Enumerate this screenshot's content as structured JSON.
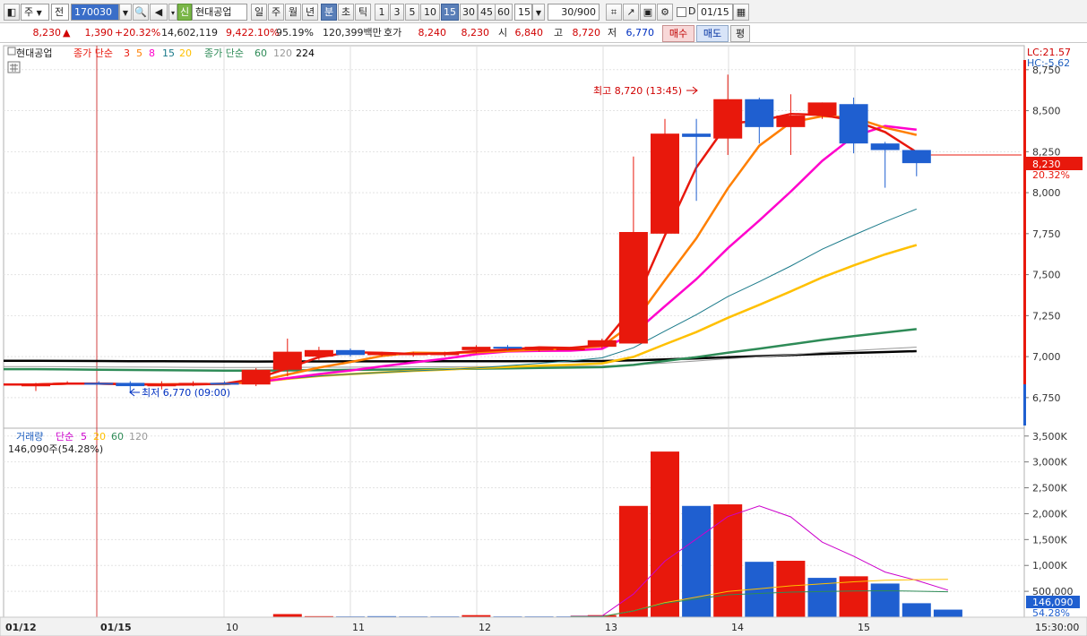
{
  "toolbar": {
    "stock_code": "170030",
    "stock_name": "현대공업",
    "badge": "신",
    "type_label": "주",
    "market_label": "전",
    "periods": [
      "일",
      "주",
      "월",
      "년",
      "분",
      "초",
      "틱"
    ],
    "active_period": "분",
    "intervals": [
      "1",
      "3",
      "5",
      "10",
      "15",
      "30",
      "45",
      "60"
    ],
    "active_interval": "15",
    "interval_value": "15",
    "count_value": "30",
    "count_total": "/900",
    "date_toggle_label": "D",
    "date_value": "01/15"
  },
  "quote": {
    "price": "8,230",
    "change": "1,390",
    "change_pct": "+20.32%",
    "volume": "14,602,119",
    "volume_pct": "9,422.10%",
    "rate": "95.19%",
    "amount": "120,399백만",
    "bid_label": "호가",
    "ask": "8,240",
    "bid": "8,230",
    "open_label": "시",
    "open": "6,840",
    "high_label": "고",
    "high": "8,720",
    "low_label": "저",
    "low": "6,770",
    "buy_label": "매수",
    "sell_label": "매도",
    "eval_label": "평"
  },
  "price_legend": {
    "name": "현대공업",
    "ma_label": "종가 단순",
    "ma_periods": [
      "3",
      "5",
      "8",
      "15",
      "20"
    ],
    "ma2_label": "종가 단순",
    "ma2_periods": [
      "60",
      "120",
      "224"
    ]
  },
  "volume_legend": {
    "label": "거래량",
    "ma_label": "단순",
    "ma_periods": [
      "5",
      "20",
      "60",
      "120"
    ],
    "current": "146,090주(54.28%)"
  },
  "annotations": {
    "high_label": "최고 8,720 (13:45)",
    "low_label": "최저 6,770 (09:00)",
    "lc": "LC:21.57",
    "hc": "HC:-5.62",
    "last_price": "8,230",
    "last_pct": "20.32%",
    "last_volume": "146,090",
    "last_volume_pct": "54.28%"
  },
  "colors": {
    "up": "#e8180c",
    "down": "#1f5fd0",
    "ma3": "#e8180c",
    "ma5": "#ff7f00",
    "ma8": "#ff00cc",
    "ma15": "#1a7a8a",
    "ma20": "#ffc000",
    "ma60": "#2e8b57",
    "ma120": "#999999",
    "ma224": "#000000"
  },
  "chart_data": {
    "type": "candlestick",
    "price_axis": {
      "ticks": [
        "8,750",
        "8,500",
        "8,250",
        "8,000",
        "7,750",
        "7,500",
        "7,250",
        "7,000",
        "6,750"
      ],
      "ylim": [
        6580,
        8880
      ]
    },
    "volume_axis": {
      "ticks": [
        "3,500K",
        "3,000K",
        "2,500K",
        "2,000K",
        "1,500K",
        "1,000K",
        "500,000"
      ],
      "ylim": [
        0,
        3600000
      ]
    },
    "x_labels": [
      "01/12",
      "01/15",
      "10",
      "11",
      "12",
      "13",
      "14",
      "15",
      "15:30:00"
    ],
    "candles": [
      {
        "o": 6820,
        "h": 6840,
        "l": 6790,
        "c": 6830
      },
      {
        "o": 6840,
        "h": 6850,
        "l": 6830,
        "c": 6840
      },
      {
        "o": 6840,
        "h": 6850,
        "l": 6830,
        "c": 6835
      },
      {
        "o": 6840,
        "h": 6850,
        "l": 6780,
        "c": 6820
      },
      {
        "o": 6820,
        "h": 6850,
        "l": 6800,
        "c": 6830
      },
      {
        "o": 6830,
        "h": 6850,
        "l": 6820,
        "c": 6840
      },
      {
        "o": 6840,
        "h": 6850,
        "l": 6830,
        "c": 6835
      },
      {
        "o": 6830,
        "h": 6930,
        "l": 6820,
        "c": 6920
      },
      {
        "o": 6920,
        "h": 7110,
        "l": 6880,
        "c": 7030
      },
      {
        "o": 7000,
        "h": 7060,
        "l": 6980,
        "c": 7040
      },
      {
        "o": 7040,
        "h": 7050,
        "l": 7000,
        "c": 7010
      },
      {
        "o": 7010,
        "h": 7030,
        "l": 7000,
        "c": 7020
      },
      {
        "o": 7010,
        "h": 7030,
        "l": 7000,
        "c": 7020
      },
      {
        "o": 7010,
        "h": 7030,
        "l": 7000,
        "c": 7020
      },
      {
        "o": 7040,
        "h": 7070,
        "l": 7020,
        "c": 7060
      },
      {
        "o": 7060,
        "h": 7070,
        "l": 7040,
        "c": 7050
      },
      {
        "o": 7040,
        "h": 7060,
        "l": 7030,
        "c": 7060
      },
      {
        "o": 7050,
        "h": 7060,
        "l": 7040,
        "c": 7050
      },
      {
        "o": 7060,
        "h": 7110,
        "l": 7050,
        "c": 7100
      },
      {
        "o": 7080,
        "h": 8220,
        "l": 7080,
        "c": 7760
      },
      {
        "o": 7750,
        "h": 8450,
        "l": 7740,
        "c": 8360
      },
      {
        "o": 8360,
        "h": 8450,
        "l": 7950,
        "c": 8340
      },
      {
        "o": 8330,
        "h": 8720,
        "l": 8230,
        "c": 8570
      },
      {
        "o": 8570,
        "h": 8580,
        "l": 8300,
        "c": 8400
      },
      {
        "o": 8400,
        "h": 8600,
        "l": 8230,
        "c": 8470
      },
      {
        "o": 8470,
        "h": 8550,
        "l": 8450,
        "c": 8550
      },
      {
        "o": 8540,
        "h": 8580,
        "l": 8240,
        "c": 8300
      },
      {
        "o": 8300,
        "h": 8310,
        "l": 8030,
        "c": 8260
      },
      {
        "o": 8260,
        "h": 8260,
        "l": 8100,
        "c": 8180
      }
    ],
    "volumes": [
      0,
      0,
      0,
      0,
      0,
      0,
      0,
      0,
      60000,
      20000,
      15000,
      20000,
      15000,
      15000,
      40000,
      15000,
      15000,
      15000,
      40000,
      2150000,
      3200000,
      2150000,
      2180000,
      1070000,
      1090000,
      760000,
      790000,
      650000,
      270000,
      146090
    ],
    "volume_up": [
      true,
      true,
      true,
      false,
      true,
      true,
      true,
      true,
      true,
      true,
      false,
      false,
      false,
      false,
      true,
      false,
      false,
      false,
      true,
      true,
      true,
      false,
      true,
      false,
      true,
      false,
      true,
      false,
      false,
      false
    ]
  }
}
